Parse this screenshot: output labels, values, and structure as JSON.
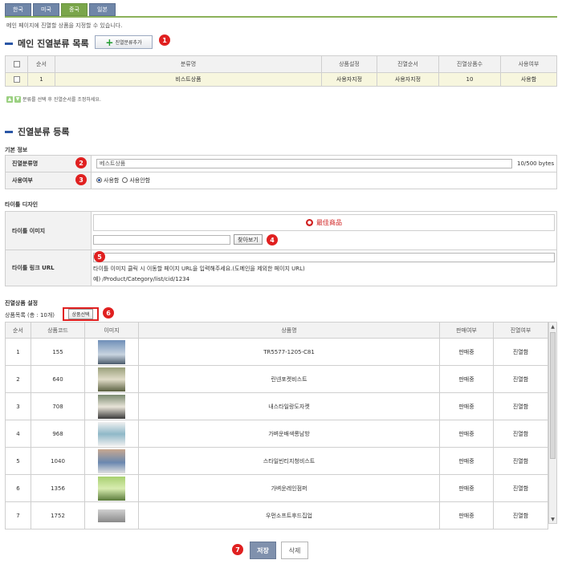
{
  "tabs": [
    "한국",
    "미국",
    "중국",
    "일본"
  ],
  "description": "메인 페이지에 진열할 상품을 지정할 수 있습니다.",
  "main_section": {
    "title": "메인 진열분류 목록",
    "add_button": "진열분류추가",
    "columns": [
      "순서",
      "분류명",
      "상품설정",
      "진열순서",
      "진열상품수",
      "사용여부"
    ],
    "rows": [
      {
        "order": "1",
        "name": "비스트상품",
        "product_setting": "사용자지정",
        "display_order": "사용자지정",
        "count": "10",
        "use": "사용함"
      }
    ],
    "move_hint": "분류를 선택 후 진열순서를 조정하세요."
  },
  "register": {
    "title": "진열분류 등록",
    "basic_info": "기본 정보",
    "name_label": "진열분류명",
    "name_value": "베스트상품",
    "name_bytes": "10/500 bytes",
    "use_label": "사용여부",
    "use_options": [
      "사용함",
      "사용안함"
    ],
    "use_selected": "사용함"
  },
  "title_design": {
    "header": "타이틀 디자인",
    "image_label": "타이틀 이미지",
    "image_text": "最佳商品",
    "browse_button": "찾아보기",
    "link_label": "타이틀 링크 URL",
    "link_help": "타이틀 이미지 클릭 시 이동할 페이지 URL을 입력해주세요.(도메인을 제외한 페이지 URL)",
    "link_example": "예) /Product/Category/list/cid/1234"
  },
  "display_products": {
    "header": "진열상품 설정",
    "list_label": "상품목록 (총 : 10개)",
    "select_button": "상품선택",
    "columns": [
      "순서",
      "상품코드",
      "이미지",
      "상품명",
      "판매여부",
      "진열여부"
    ],
    "rows": [
      {
        "order": "1",
        "code": "155",
        "name": "TR5577-1205-C81",
        "sale": "판매중",
        "display": "진열함"
      },
      {
        "order": "2",
        "code": "640",
        "name": "린넨포켓비스트",
        "sale": "판매중",
        "display": "진열함"
      },
      {
        "order": "3",
        "code": "708",
        "name": "내스타일랑도자켓",
        "sale": "판매중",
        "display": "진열함"
      },
      {
        "order": "4",
        "code": "968",
        "name": "가벼운배색롱남방",
        "sale": "판매중",
        "display": "진열함"
      },
      {
        "order": "5",
        "code": "1040",
        "name": "스타일빈티지청비스트",
        "sale": "판매중",
        "display": "진열함"
      },
      {
        "order": "6",
        "code": "1356",
        "name": "가벼운레인점퍼",
        "sale": "판매중",
        "display": "진열함"
      },
      {
        "order": "7",
        "code": "1752",
        "name": "우먼소프트후드집업",
        "sale": "판매중",
        "display": "진열함"
      }
    ]
  },
  "actions": {
    "save": "저장",
    "delete": "삭제"
  },
  "badges": [
    "1",
    "2",
    "3",
    "4",
    "5",
    "6",
    "7"
  ],
  "colors": {
    "accent_green": "#7aa64a",
    "tab_blue": "#6f86a8",
    "badge_red": "#e02020",
    "highlight_row": "#f7f6de"
  }
}
